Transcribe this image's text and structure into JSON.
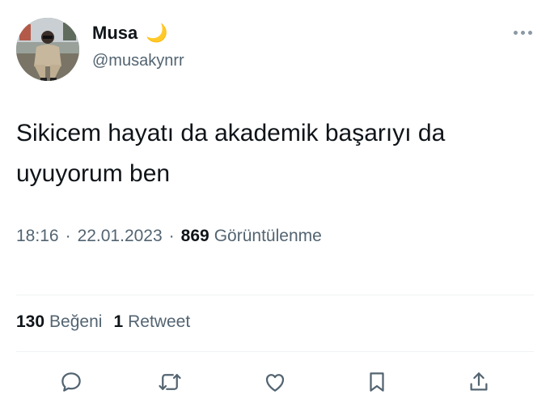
{
  "user": {
    "display_name": "Musa",
    "emoji": "🌙",
    "handle": "@musakynrr"
  },
  "tweet": {
    "text": "Sikicem hayatı da akademik başarıyı da uyuyorum ben",
    "time": "18:16",
    "date": "22.01.2023",
    "separator": "·",
    "views_count": "869",
    "views_label": "Görüntülenme"
  },
  "stats": {
    "likes_count": "130",
    "likes_label": "Beğeni",
    "retweets_count": "1",
    "retweets_label": "Retweet"
  },
  "icons": {
    "more": "more-horizontal-icon",
    "reply": "reply-icon",
    "retweet": "retweet-icon",
    "like": "heart-icon",
    "bookmark": "bookmark-icon",
    "share": "share-icon"
  },
  "colors": {
    "text_primary": "#0f1419",
    "text_secondary": "#536471",
    "divider": "#eff3f4",
    "moon": "#f2c230"
  }
}
